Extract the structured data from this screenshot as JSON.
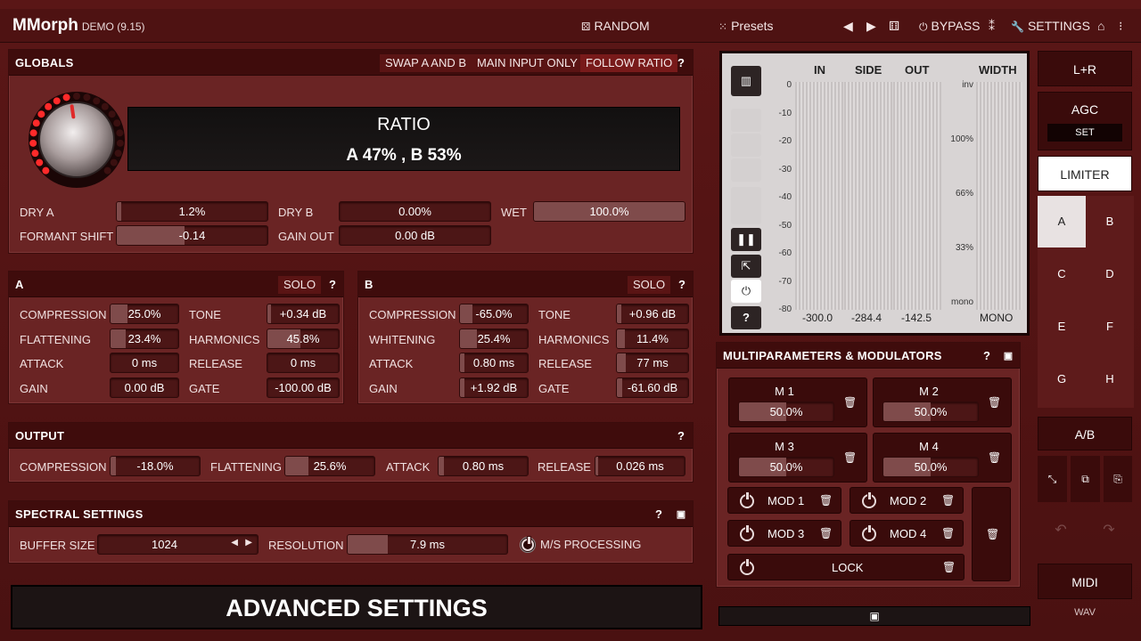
{
  "topbar": {
    "app_name": "MMorph",
    "version": "DEMO (9.15)",
    "random": "RANDOM",
    "presets": "Presets",
    "bypass": "BYPASS",
    "settings": "SETTINGS"
  },
  "globals": {
    "title": "GLOBALS",
    "swap": "SWAP A AND B",
    "main_input": "MAIN INPUT ONLY",
    "follow": "FOLLOW RATIO",
    "help": "?",
    "ratio_title": "RATIO",
    "ratio_value": "A 47% , B 53%",
    "knob_level": 0.47,
    "params": [
      {
        "label": "DRY A",
        "value": "1.2%",
        "fill": 0.03
      },
      {
        "label": "DRY B",
        "value": "0.00%",
        "fill": 0.0
      },
      {
        "label": "WET",
        "value": "100.0%",
        "fill": 1.0
      },
      {
        "label": "FORMANT SHIFT",
        "value": "-0.14",
        "fill": 0.45
      },
      {
        "label": "GAIN OUT",
        "value": "0.00 dB",
        "fill": 0.0
      }
    ]
  },
  "sectionA": {
    "title": "A",
    "solo": "SOLO",
    "help": "?",
    "params": [
      {
        "label": "COMPRESSION",
        "value": "25.0%",
        "fill": 0.25
      },
      {
        "label": "TONE",
        "value": "+0.34 dB",
        "fill": 0.05
      },
      {
        "label": "FLATTENING",
        "value": "23.4%",
        "fill": 0.23
      },
      {
        "label": "HARMONICS",
        "value": "45.8%",
        "fill": 0.46
      },
      {
        "label": "ATTACK",
        "value": "0 ms",
        "fill": 0.0
      },
      {
        "label": "RELEASE",
        "value": "0 ms",
        "fill": 0.0
      },
      {
        "label": "GAIN",
        "value": "0.00 dB",
        "fill": 0.0
      },
      {
        "label": "GATE",
        "value": "-100.00 dB",
        "fill": 0.0
      }
    ]
  },
  "sectionB": {
    "title": "B",
    "solo": "SOLO",
    "help": "?",
    "params": [
      {
        "label": "COMPRESSION",
        "value": "-65.0%",
        "fill": 0.18
      },
      {
        "label": "TONE",
        "value": "+0.96 dB",
        "fill": 0.06
      },
      {
        "label": "WHITENING",
        "value": "25.4%",
        "fill": 0.25
      },
      {
        "label": "HARMONICS",
        "value": "11.4%",
        "fill": 0.11
      },
      {
        "label": "ATTACK",
        "value": "0.80 ms",
        "fill": 0.06
      },
      {
        "label": "RELEASE",
        "value": "77 ms",
        "fill": 0.12
      },
      {
        "label": "GAIN",
        "value": "+1.92 dB",
        "fill": 0.06
      },
      {
        "label": "GATE",
        "value": "-61.60 dB",
        "fill": 0.08
      }
    ]
  },
  "output": {
    "title": "OUTPUT",
    "help": "?",
    "params": [
      {
        "label": "COMPRESSION",
        "value": "-18.0%",
        "fill": 0.06
      },
      {
        "label": "FLATTENING",
        "value": "25.6%",
        "fill": 0.26
      },
      {
        "label": "ATTACK",
        "value": "0.80 ms",
        "fill": 0.06
      },
      {
        "label": "RELEASE",
        "value": "0.026 ms",
        "fill": 0.03
      }
    ]
  },
  "spectral": {
    "title": "SPECTRAL SETTINGS",
    "help": "?",
    "buffer_label": "BUFFER SIZE",
    "buffer_value": "1024",
    "resolution_label": "RESOLUTION",
    "resolution_value": "7.9 ms",
    "resolution_fill": 0.25,
    "ms_label": "M/S PROCESSING"
  },
  "advanced": "ADVANCED SETTINGS",
  "meter": {
    "headers": [
      "IN",
      "SIDE",
      "OUT",
      "WIDTH"
    ],
    "db_ticks": [
      "0",
      "-10",
      "-20",
      "-30",
      "-40",
      "-50",
      "-60",
      "-70",
      "-80"
    ],
    "width_ticks": [
      "inv",
      "100%",
      "66%",
      "33%",
      "mono"
    ],
    "bottom": [
      "-300.0",
      "-284.4",
      "-142.5",
      "MONO"
    ],
    "help": "?"
  },
  "right": {
    "lr": "L+R",
    "agc": "AGC",
    "set": "SET",
    "limiter": "LIMITER",
    "presets": [
      "A",
      "B",
      "C",
      "D",
      "E",
      "F",
      "G",
      "H"
    ],
    "ab": "A/B",
    "midi": "MIDI",
    "wav": "WAV"
  },
  "multi": {
    "title": "MULTIPARAMETERS & MODULATORS",
    "help": "?",
    "cards": [
      {
        "name": "M 1",
        "value": "50.0%",
        "fill": 0.5
      },
      {
        "name": "M 2",
        "value": "50.0%",
        "fill": 0.5
      },
      {
        "name": "M 3",
        "value": "50.0%",
        "fill": 0.5
      },
      {
        "name": "M 4",
        "value": "50.0%",
        "fill": 0.5
      }
    ],
    "mods": [
      "MOD 1",
      "MOD 2",
      "MOD 3",
      "MOD 4"
    ],
    "lock": "LOCK"
  }
}
